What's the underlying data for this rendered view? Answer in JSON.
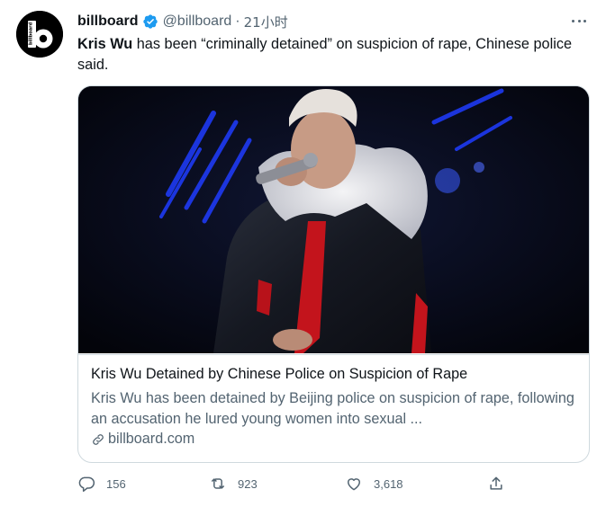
{
  "tweet": {
    "display_name": "billboard",
    "handle": "@billboard",
    "separator": "·",
    "time": "21小时",
    "text_bold": "Kris Wu",
    "text_rest": " has been “criminally detained” on suspicion of rape, Chinese police said."
  },
  "card": {
    "title": "Kris Wu Detained by Chinese Police on Suspicion of Rape",
    "description": "Kris Wu has been detained by Beijing police on suspicion of rape, following an accusation he lured young women into sexual ...",
    "domain": "billboard.com"
  },
  "actions": {
    "replies": "156",
    "retweets": "923",
    "likes": "3,618"
  },
  "colors": {
    "verified": "#1d9bf0",
    "secondary_text": "#536471",
    "border": "#cfd9de"
  },
  "icons": [
    "billboard-logo",
    "verified-badge-icon",
    "more-icon",
    "link-icon",
    "reply-icon",
    "retweet-icon",
    "like-icon",
    "share-icon"
  ]
}
